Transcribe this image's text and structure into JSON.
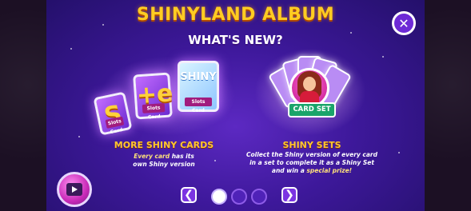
{
  "header": {
    "title": "SHINYLAND ALBUM",
    "subtitle": "WHAT'S NEW?"
  },
  "close_button": {
    "icon": "close-icon",
    "symbol": "✕"
  },
  "left_feature": {
    "heading": "MORE SHINY CARDS",
    "desc_bold": "Every card",
    "desc_rest_line1": " has its",
    "desc_line2": "own Shiny version",
    "cards": [
      {
        "glyph": "S",
        "caption": "Slots Card"
      },
      {
        "glyph": "+e",
        "caption": "Slots Card"
      },
      {
        "word": "SHINY",
        "caption": "Slots Card"
      }
    ]
  },
  "right_feature": {
    "heading": "SHINY SETS",
    "desc_line1": "Collect the Shiny version of every card",
    "desc_line2": "in a set to complete it as a Shiny Set",
    "desc_line3_pre": "and win a ",
    "desc_line3_bold": "special prize!",
    "badge": "CARD SET"
  },
  "video_button": {
    "icon": "video-icon"
  },
  "pager": {
    "prev_icon": "chevron-left-icon",
    "next_icon": "chevron-right-icon",
    "prev_symbol": "❮",
    "next_symbol": "❯",
    "pages": 3,
    "current": 1
  },
  "colors": {
    "title": "#ffcc22",
    "accent_purple": "#6e2ad6",
    "heading_gold": "#ffc733",
    "ribbon_green": "#1aa46a"
  }
}
